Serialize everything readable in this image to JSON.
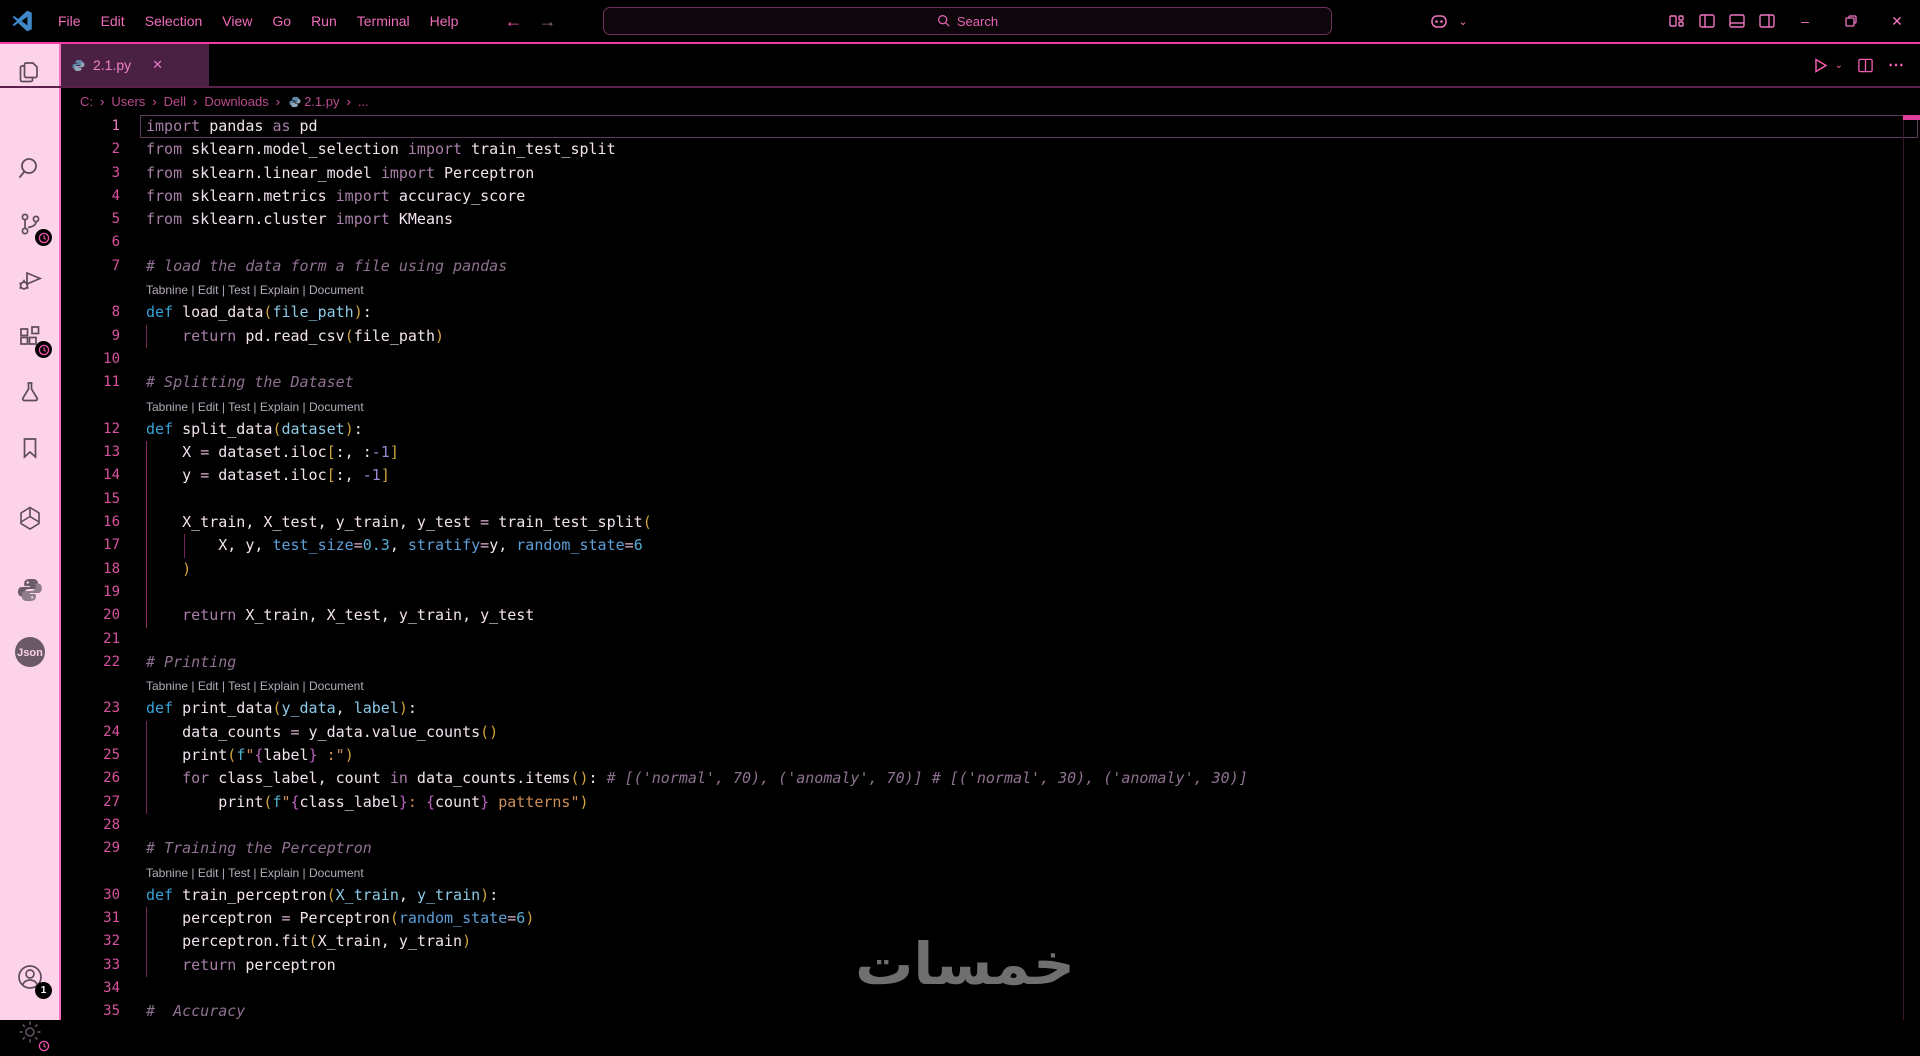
{
  "title_bar": {
    "menus": [
      "File",
      "Edit",
      "Selection",
      "View",
      "Go",
      "Run",
      "Terminal",
      "Help"
    ],
    "search_label": "Search"
  },
  "tab": {
    "label": "2.1.py"
  },
  "breadcrumb": {
    "items": [
      "C:",
      "Users",
      "Dell",
      "Downloads"
    ],
    "file": "2.1.py",
    "tail": "..."
  },
  "activity_bar": {
    "account_badge": "1"
  },
  "editor": {
    "codelens": "Tabnine | Edit | Test | Explain | Document",
    "rows": [
      {
        "n": 1,
        "tokens": [
          [
            "kw",
            "import"
          ],
          [
            "tx",
            " pandas "
          ],
          [
            "kw",
            "as"
          ],
          [
            "tx",
            " pd"
          ]
        ]
      },
      {
        "n": 2,
        "tokens": [
          [
            "kw",
            "from"
          ],
          [
            "tx",
            " sklearn.model_selection "
          ],
          [
            "kw",
            "import"
          ],
          [
            "tx",
            " train_test_split"
          ]
        ]
      },
      {
        "n": 3,
        "tokens": [
          [
            "kw",
            "from"
          ],
          [
            "tx",
            " sklearn.linear_model "
          ],
          [
            "kw",
            "import"
          ],
          [
            "tx",
            " Perceptron"
          ]
        ]
      },
      {
        "n": 4,
        "tokens": [
          [
            "kw",
            "from"
          ],
          [
            "tx",
            " sklearn.metrics "
          ],
          [
            "kw",
            "import"
          ],
          [
            "tx",
            " accuracy_score"
          ]
        ]
      },
      {
        "n": 5,
        "tokens": [
          [
            "kw",
            "from"
          ],
          [
            "tx",
            " sklearn.cluster "
          ],
          [
            "kw",
            "import"
          ],
          [
            "tx",
            " KMeans"
          ]
        ]
      },
      {
        "n": 6,
        "tokens": []
      },
      {
        "n": 7,
        "tokens": [
          [
            "cm",
            "# load the data form a file using pandas"
          ]
        ]
      },
      {
        "lens": true
      },
      {
        "n": 8,
        "tokens": [
          [
            "df",
            "def "
          ],
          [
            "fn",
            "load_data"
          ],
          [
            "p",
            "("
          ],
          [
            "pm",
            "file_path"
          ],
          [
            "p",
            ")"
          ],
          [
            "tx",
            ":"
          ]
        ]
      },
      {
        "n": 9,
        "tokens": [
          [
            "tx",
            "    "
          ],
          [
            "kw",
            "return"
          ],
          [
            "tx",
            " pd.read_csv"
          ],
          [
            "p",
            "("
          ],
          [
            "tx",
            "file_path"
          ],
          [
            "p",
            ")"
          ]
        ]
      },
      {
        "n": 10,
        "tokens": []
      },
      {
        "n": 11,
        "tokens": [
          [
            "cm",
            "# Splitting the Dataset"
          ]
        ]
      },
      {
        "lens": true
      },
      {
        "n": 12,
        "tokens": [
          [
            "df",
            "def "
          ],
          [
            "fn",
            "split_data"
          ],
          [
            "p",
            "("
          ],
          [
            "pm",
            "dataset"
          ],
          [
            "p",
            ")"
          ],
          [
            "tx",
            ":"
          ]
        ]
      },
      {
        "n": 13,
        "tokens": [
          [
            "tx",
            "    X "
          ],
          [
            "op",
            "="
          ],
          [
            "tx",
            " dataset.iloc"
          ],
          [
            "p",
            "["
          ],
          [
            "tx",
            ":, :"
          ],
          [
            "nv",
            "-1"
          ],
          [
            "p",
            "]"
          ]
        ]
      },
      {
        "n": 14,
        "tokens": [
          [
            "tx",
            "    y "
          ],
          [
            "op",
            "="
          ],
          [
            "tx",
            " dataset.iloc"
          ],
          [
            "p",
            "["
          ],
          [
            "tx",
            ":, "
          ],
          [
            "nv",
            "-1"
          ],
          [
            "p",
            "]"
          ]
        ]
      },
      {
        "n": 15,
        "tokens": []
      },
      {
        "n": 16,
        "tokens": [
          [
            "tx",
            "    X_train, X_test, y_train, y_test "
          ],
          [
            "op",
            "="
          ],
          [
            "tx",
            " train_test_split"
          ],
          [
            "p",
            "("
          ]
        ]
      },
      {
        "n": 17,
        "tokens": [
          [
            "tx",
            "        X, y, "
          ],
          [
            "na",
            "test_size"
          ],
          [
            "op",
            "="
          ],
          [
            "nu",
            "0.3"
          ],
          [
            "tx",
            ", "
          ],
          [
            "na",
            "stratify"
          ],
          [
            "op",
            "="
          ],
          [
            "tx",
            "y, "
          ],
          [
            "na",
            "random_state"
          ],
          [
            "op",
            "="
          ],
          [
            "nu",
            "6"
          ]
        ]
      },
      {
        "n": 18,
        "tokens": [
          [
            "tx",
            "    "
          ],
          [
            "p",
            ")"
          ]
        ]
      },
      {
        "n": 19,
        "tokens": []
      },
      {
        "n": 20,
        "tokens": [
          [
            "tx",
            "    "
          ],
          [
            "kw",
            "return"
          ],
          [
            "tx",
            " X_train, X_test, y_train, y_test"
          ]
        ]
      },
      {
        "n": 21,
        "tokens": []
      },
      {
        "n": 22,
        "tokens": [
          [
            "cm",
            "# Printing"
          ]
        ]
      },
      {
        "lens": true
      },
      {
        "n": 23,
        "tokens": [
          [
            "df",
            "def "
          ],
          [
            "fn",
            "print_data"
          ],
          [
            "p",
            "("
          ],
          [
            "pm",
            "y_data"
          ],
          [
            "tx",
            ", "
          ],
          [
            "pm",
            "label"
          ],
          [
            "p",
            ")"
          ],
          [
            "tx",
            ":"
          ]
        ]
      },
      {
        "n": 24,
        "tokens": [
          [
            "tx",
            "    data_counts "
          ],
          [
            "op",
            "="
          ],
          [
            "tx",
            " y_data.value_counts"
          ],
          [
            "p",
            "()"
          ]
        ]
      },
      {
        "n": 25,
        "tokens": [
          [
            "tx",
            "    print"
          ],
          [
            "p",
            "("
          ],
          [
            "fs",
            "f"
          ],
          [
            "st",
            "\""
          ],
          [
            "br",
            "{"
          ],
          [
            "tx",
            "label"
          ],
          [
            "br",
            "}"
          ],
          [
            "st",
            " :\""
          ],
          [
            "p",
            ")"
          ]
        ]
      },
      {
        "n": 26,
        "tokens": [
          [
            "tx",
            "    "
          ],
          [
            "kw",
            "for"
          ],
          [
            "tx",
            " class_label, count "
          ],
          [
            "kw",
            "in"
          ],
          [
            "tx",
            " data_counts.items"
          ],
          [
            "p",
            "()"
          ],
          [
            "tx",
            ": "
          ],
          [
            "cm",
            "# [('normal', 70), ('anomaly', 70)] # [('normal', 30), ('anomaly', 30)]"
          ]
        ]
      },
      {
        "n": 27,
        "tokens": [
          [
            "tx",
            "        print"
          ],
          [
            "p",
            "("
          ],
          [
            "fs",
            "f"
          ],
          [
            "st",
            "\""
          ],
          [
            "br",
            "{"
          ],
          [
            "tx",
            "class_label"
          ],
          [
            "br",
            "}"
          ],
          [
            "st",
            ": "
          ],
          [
            "br",
            "{"
          ],
          [
            "tx",
            "count"
          ],
          [
            "br",
            "}"
          ],
          [
            "st",
            " patterns\""
          ],
          [
            "p",
            ")"
          ]
        ]
      },
      {
        "n": 28,
        "tokens": []
      },
      {
        "n": 29,
        "tokens": [
          [
            "cm",
            "# Training the Perceptron"
          ]
        ]
      },
      {
        "lens": true
      },
      {
        "n": 30,
        "tokens": [
          [
            "df",
            "def "
          ],
          [
            "fn",
            "train_perceptron"
          ],
          [
            "p",
            "("
          ],
          [
            "pm",
            "X_train"
          ],
          [
            "tx",
            ", "
          ],
          [
            "pm",
            "y_train"
          ],
          [
            "p",
            ")"
          ],
          [
            "tx",
            ":"
          ]
        ]
      },
      {
        "n": 31,
        "tokens": [
          [
            "tx",
            "    perceptron "
          ],
          [
            "op",
            "="
          ],
          [
            "tx",
            " Perceptron"
          ],
          [
            "p",
            "("
          ],
          [
            "na",
            "random_state"
          ],
          [
            "op",
            "="
          ],
          [
            "nu",
            "6"
          ],
          [
            "p",
            ")"
          ]
        ]
      },
      {
        "n": 32,
        "tokens": [
          [
            "tx",
            "    perceptron.fit"
          ],
          [
            "p",
            "("
          ],
          [
            "tx",
            "X_train, y_train"
          ],
          [
            "p",
            ")"
          ]
        ]
      },
      {
        "n": 33,
        "tokens": [
          [
            "tx",
            "    "
          ],
          [
            "kw",
            "return"
          ],
          [
            "tx",
            " perceptron"
          ]
        ]
      },
      {
        "n": 34,
        "tokens": []
      },
      {
        "n": 35,
        "tokens": [
          [
            "cm",
            "#  Accuracy"
          ]
        ]
      }
    ]
  },
  "watermark": "خمسات",
  "colors": {
    "accent_pink": "#ef3ca3",
    "activity_bar_bg": "#fdd3e9",
    "tab_active_bg": "#4a2043",
    "menu_text": "#ef6cbb",
    "line_number": "#d8539f",
    "keyword": "#a77ea7",
    "def_keyword": "#38a1d8",
    "comment": "#8e7190",
    "paren": "#d0a43e",
    "string": "#cd8d56",
    "named_arg": "#5c9fd8",
    "python_logo_blue": "#5e87a8"
  }
}
